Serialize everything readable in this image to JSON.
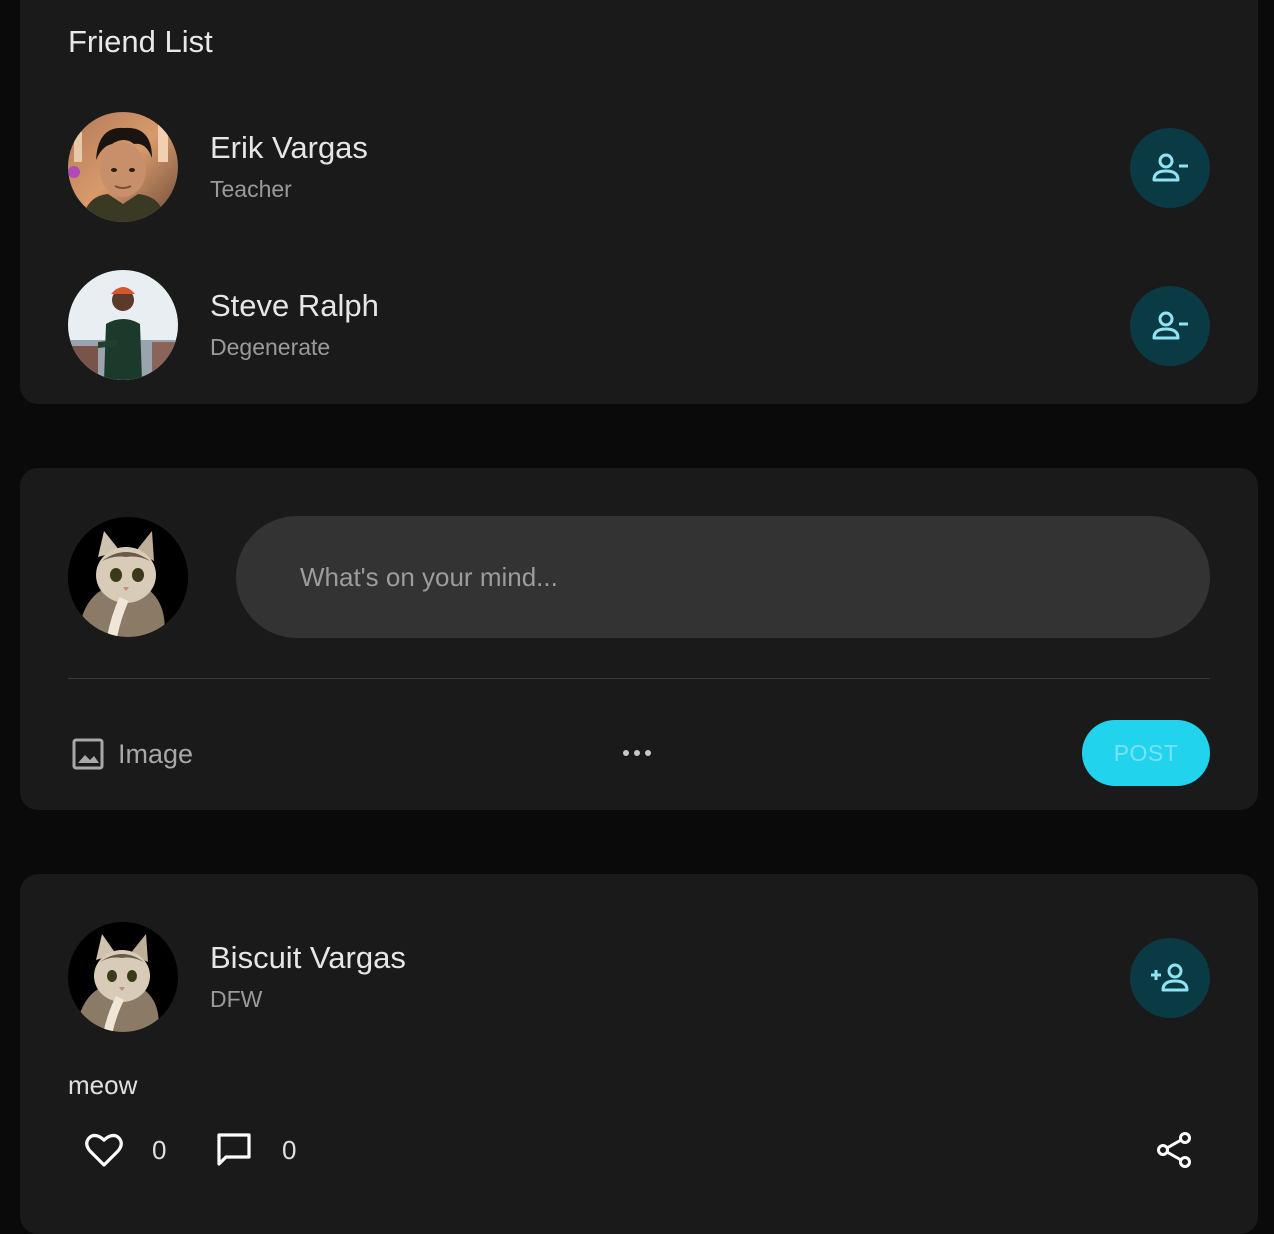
{
  "friend_list": {
    "title": "Friend List",
    "friends": [
      {
        "name": "Erik Vargas",
        "subtitle": "Teacher",
        "action_icon": "person-remove-icon"
      },
      {
        "name": "Steve Ralph",
        "subtitle": "Degenerate",
        "action_icon": "person-remove-icon"
      }
    ]
  },
  "composer": {
    "placeholder": "What's on your mind...",
    "image_label": "Image",
    "more_icon": "more-horizontal-icon",
    "post_label": "POST"
  },
  "post": {
    "author": "Biscuit Vargas",
    "location": "DFW",
    "action_icon": "person-add-icon",
    "text": "meow",
    "likes": "0",
    "comments": "0",
    "share_icon": "share-icon"
  },
  "colors": {
    "background": "#0a0a0a",
    "card": "#1a1a1a",
    "accent": "#22d3ee",
    "icon_button_bg": "#0a3a44",
    "icon_accent": "#8fe3f2"
  }
}
